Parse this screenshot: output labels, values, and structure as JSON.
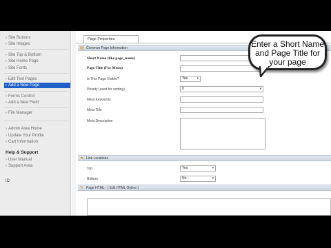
{
  "sidebar": {
    "items": [
      {
        "label": "Site Buttons"
      },
      {
        "label": "Site Images"
      },
      {
        "label": "Site Top & Bottom"
      },
      {
        "label": "Site Home Page"
      },
      {
        "label": "Site Fonts"
      },
      {
        "label": "Edit Text Pages"
      },
      {
        "label": "Add a New Page"
      },
      {
        "label": "Forms Control"
      },
      {
        "label": "Add a New Field"
      },
      {
        "label": "File Manager"
      },
      {
        "label": "Admin Area Home"
      },
      {
        "label": "Update Your Profile"
      },
      {
        "label": "Cart Information"
      }
    ],
    "help_heading": "Help & Support",
    "help_items": [
      {
        "label": "User Manual"
      },
      {
        "label": "Support Area"
      }
    ],
    "footer": "ID"
  },
  "main": {
    "tab_label": "Page Properties",
    "common_section": "Common Page Information",
    "fields": {
      "short_name_label": "Short Name (like page_name)",
      "page_title_label": "Page Title (For Menu)",
      "visible_label": "Is This Page Visible?",
      "visible_value": "Yes",
      "priority_label": "Priority (used for sorting)",
      "priority_value": "0",
      "meta_keywords_label": "Meta Keywords",
      "meta_title_label": "Meta Title",
      "meta_description_label": "Meta Description"
    },
    "link_section": "Link Locations",
    "links": {
      "top_label": "Top",
      "top_value": "Yes",
      "bottom_label": "Bottom",
      "bottom_value": "No"
    },
    "html_section": "Page HTML - [ Edit HTML Online ]"
  },
  "callout": {
    "line1": "Enter a Short Name",
    "line2": "and Page Title for",
    "line3": "your page"
  },
  "colors": {
    "active_item": "#1f5fc8",
    "section_header": "#d6dde8",
    "letterbox": "#000000"
  }
}
